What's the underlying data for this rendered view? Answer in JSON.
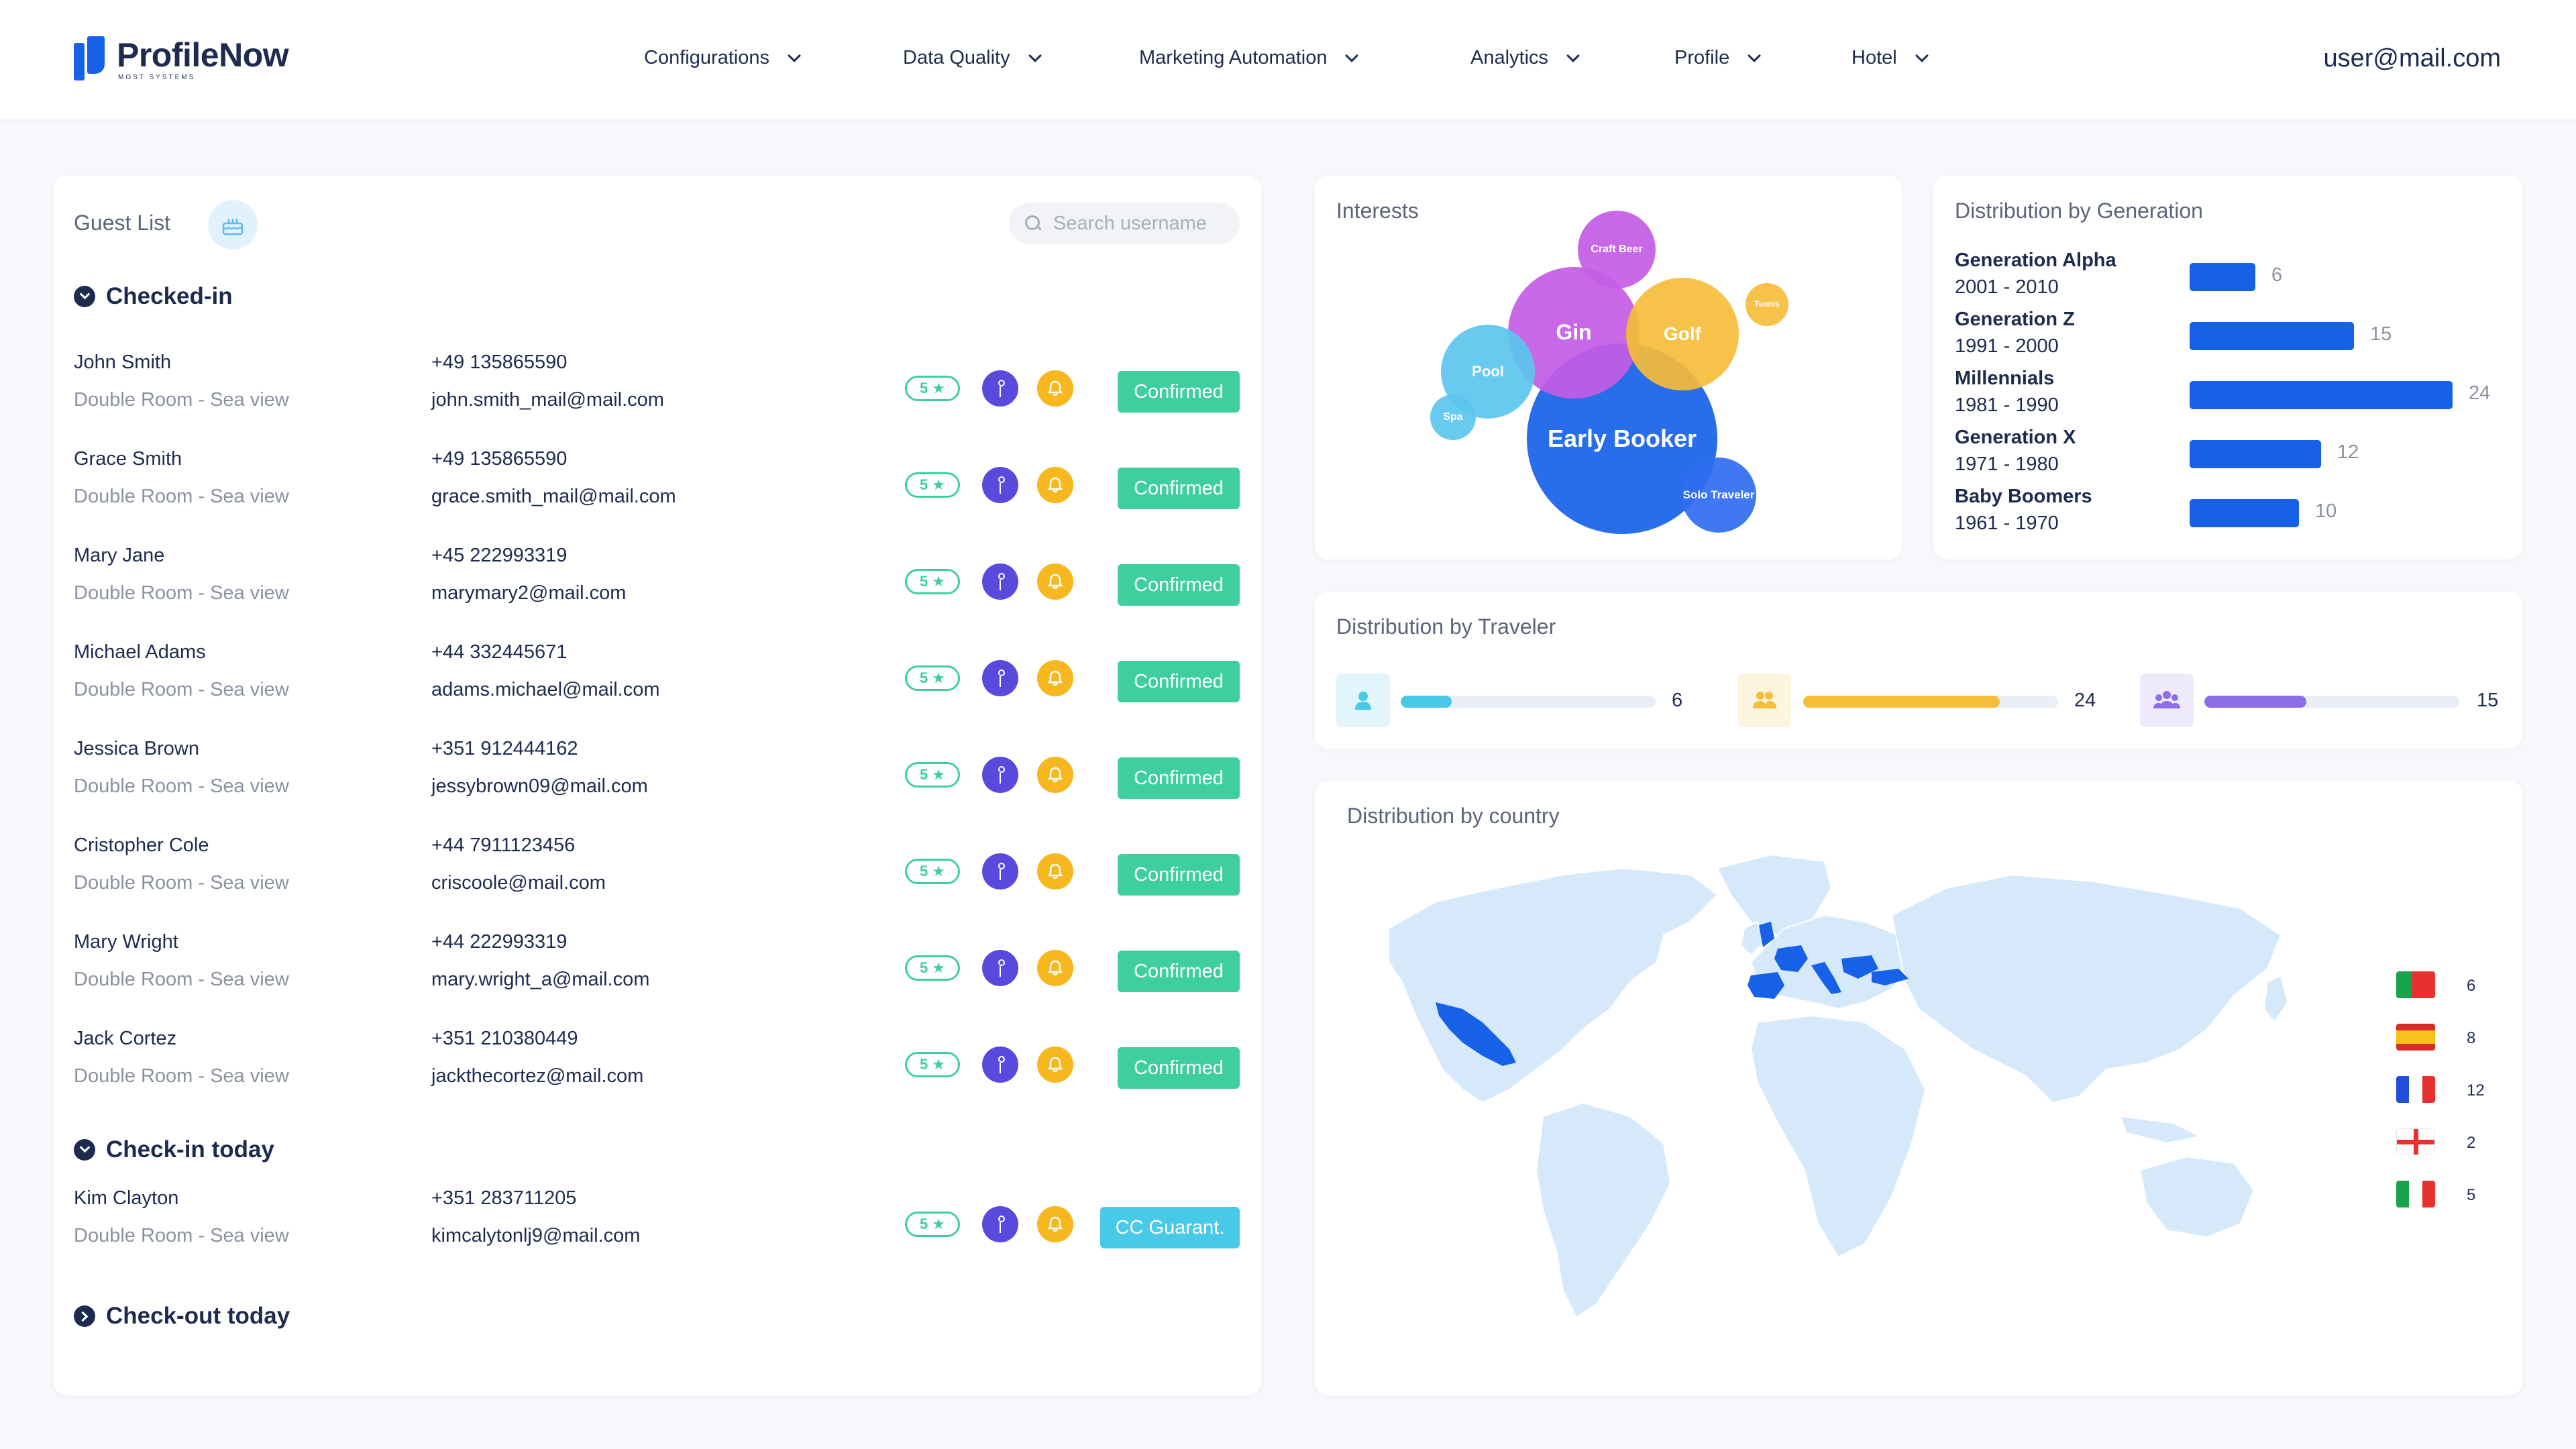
{
  "header": {
    "logo_name": "ProfileNow",
    "logo_sub": "MOST SYSTEMS",
    "nav": [
      {
        "label": "Configurations"
      },
      {
        "label": "Data Quality"
      },
      {
        "label": "Marketing Automation"
      },
      {
        "label": "Analytics"
      },
      {
        "label": "Profile"
      },
      {
        "label": "Hotel"
      }
    ],
    "user_email": "user@mail.com"
  },
  "guest_list": {
    "title": "Guest List",
    "search_placeholder": "Search username",
    "sections": [
      {
        "label": "Checked-in",
        "expanded": true
      },
      {
        "label": "Check-in today",
        "expanded": true
      },
      {
        "label": "Check-out today",
        "expanded": false
      }
    ],
    "checked_in": [
      {
        "name": "John Smith",
        "room": "Double Room - Sea view",
        "phone": "+49 135865590",
        "email": "john.smith_mail@mail.com",
        "stars": "5 ★",
        "status": "Confirmed"
      },
      {
        "name": "Grace Smith",
        "room": "Double Room - Sea view",
        "phone": "+49 135865590",
        "email": "grace.smith_mail@mail.com",
        "stars": "5 ★",
        "status": "Confirmed"
      },
      {
        "name": "Mary Jane",
        "room": "Double Room - Sea view",
        "phone": "+45 222993319",
        "email": "marymary2@mail.com",
        "stars": "5 ★",
        "status": "Confirmed"
      },
      {
        "name": "Michael Adams",
        "room": "Double Room - Sea view",
        "phone": "+44 332445671",
        "email": "adams.michael@mail.com",
        "stars": "5 ★",
        "status": "Confirmed"
      },
      {
        "name": "Jessica Brown",
        "room": "Double Room - Sea view",
        "phone": "+351 912444162",
        "email": "jessybrown09@mail.com",
        "stars": "5 ★",
        "status": "Confirmed"
      },
      {
        "name": "Cristopher Cole",
        "room": "Double Room - Sea view",
        "phone": "+44 7911123456",
        "email": "criscoole@mail.com",
        "stars": "5 ★",
        "status": "Confirmed"
      },
      {
        "name": "Mary Wright",
        "room": "Double Room - Sea view",
        "phone": "+44 222993319",
        "email": "mary.wright_a@mail.com",
        "stars": "5 ★",
        "status": "Confirmed"
      },
      {
        "name": "Jack Cortez",
        "room": "Double Room - Sea view",
        "phone": "+351 210380449",
        "email": "jackthecortez@mail.com",
        "stars": "5 ★",
        "status": "Confirmed"
      }
    ],
    "check_in_today": [
      {
        "name": "Kim Clayton",
        "room": "Double Room - Sea view",
        "phone": "+351 283711205",
        "email": "kimcalytonlj9@mail.com",
        "stars": "5 ★",
        "status": "CC Guarant."
      }
    ]
  },
  "interests": {
    "title": "Interests",
    "bubbles": [
      {
        "label": "Early Booker",
        "color": "#1661e8"
      },
      {
        "label": "Gin",
        "color": "#c55ce6"
      },
      {
        "label": "Golf",
        "color": "#f6bd3a"
      },
      {
        "label": "Pool",
        "color": "#5cc6ee"
      },
      {
        "label": "Craft Beer",
        "color": "#c55ce6"
      },
      {
        "label": "Tennis",
        "color": "#f6bd3a"
      },
      {
        "label": "Spa",
        "color": "#5cc6ee"
      },
      {
        "label": "Solo Traveler",
        "color": "#2f6df0"
      }
    ]
  },
  "generation": {
    "title": "Distribution by Generation",
    "rows": [
      {
        "name": "Generation Alpha",
        "years": "2001 - 2010",
        "value": 6
      },
      {
        "name": "Generation Z",
        "years": "1991 - 2000",
        "value": 15
      },
      {
        "name": "Millennials",
        "years": "1981 - 1990",
        "value": 24
      },
      {
        "name": "Generation X",
        "years": "1971 - 1980",
        "value": 12
      },
      {
        "name": "Baby Boomers",
        "years": "1961 - 1970",
        "value": 10
      }
    ]
  },
  "traveler": {
    "title": "Distribution by Traveler",
    "rows": [
      {
        "icon": "person-icon",
        "value": 6,
        "fill_fraction": 0.2,
        "color": "#48c9e8",
        "bg": "#e2f4fc"
      },
      {
        "icon": "couple-icon",
        "value": 24,
        "fill_fraction": 0.77,
        "color": "#f6bd3a",
        "bg": "#fdf4df"
      },
      {
        "icon": "group-icon",
        "value": 15,
        "fill_fraction": 0.4,
        "color": "#8c6ee6",
        "bg": "#eeeafb"
      }
    ]
  },
  "country": {
    "title": "Distribution by country",
    "legend": [
      {
        "flag": "portugal-flag",
        "value": "6"
      },
      {
        "flag": "spain-flag",
        "value": "8"
      },
      {
        "flag": "france-flag",
        "value": "12"
      },
      {
        "flag": "england-flag",
        "value": "2"
      },
      {
        "flag": "italy-flag",
        "value": "5"
      }
    ]
  }
}
